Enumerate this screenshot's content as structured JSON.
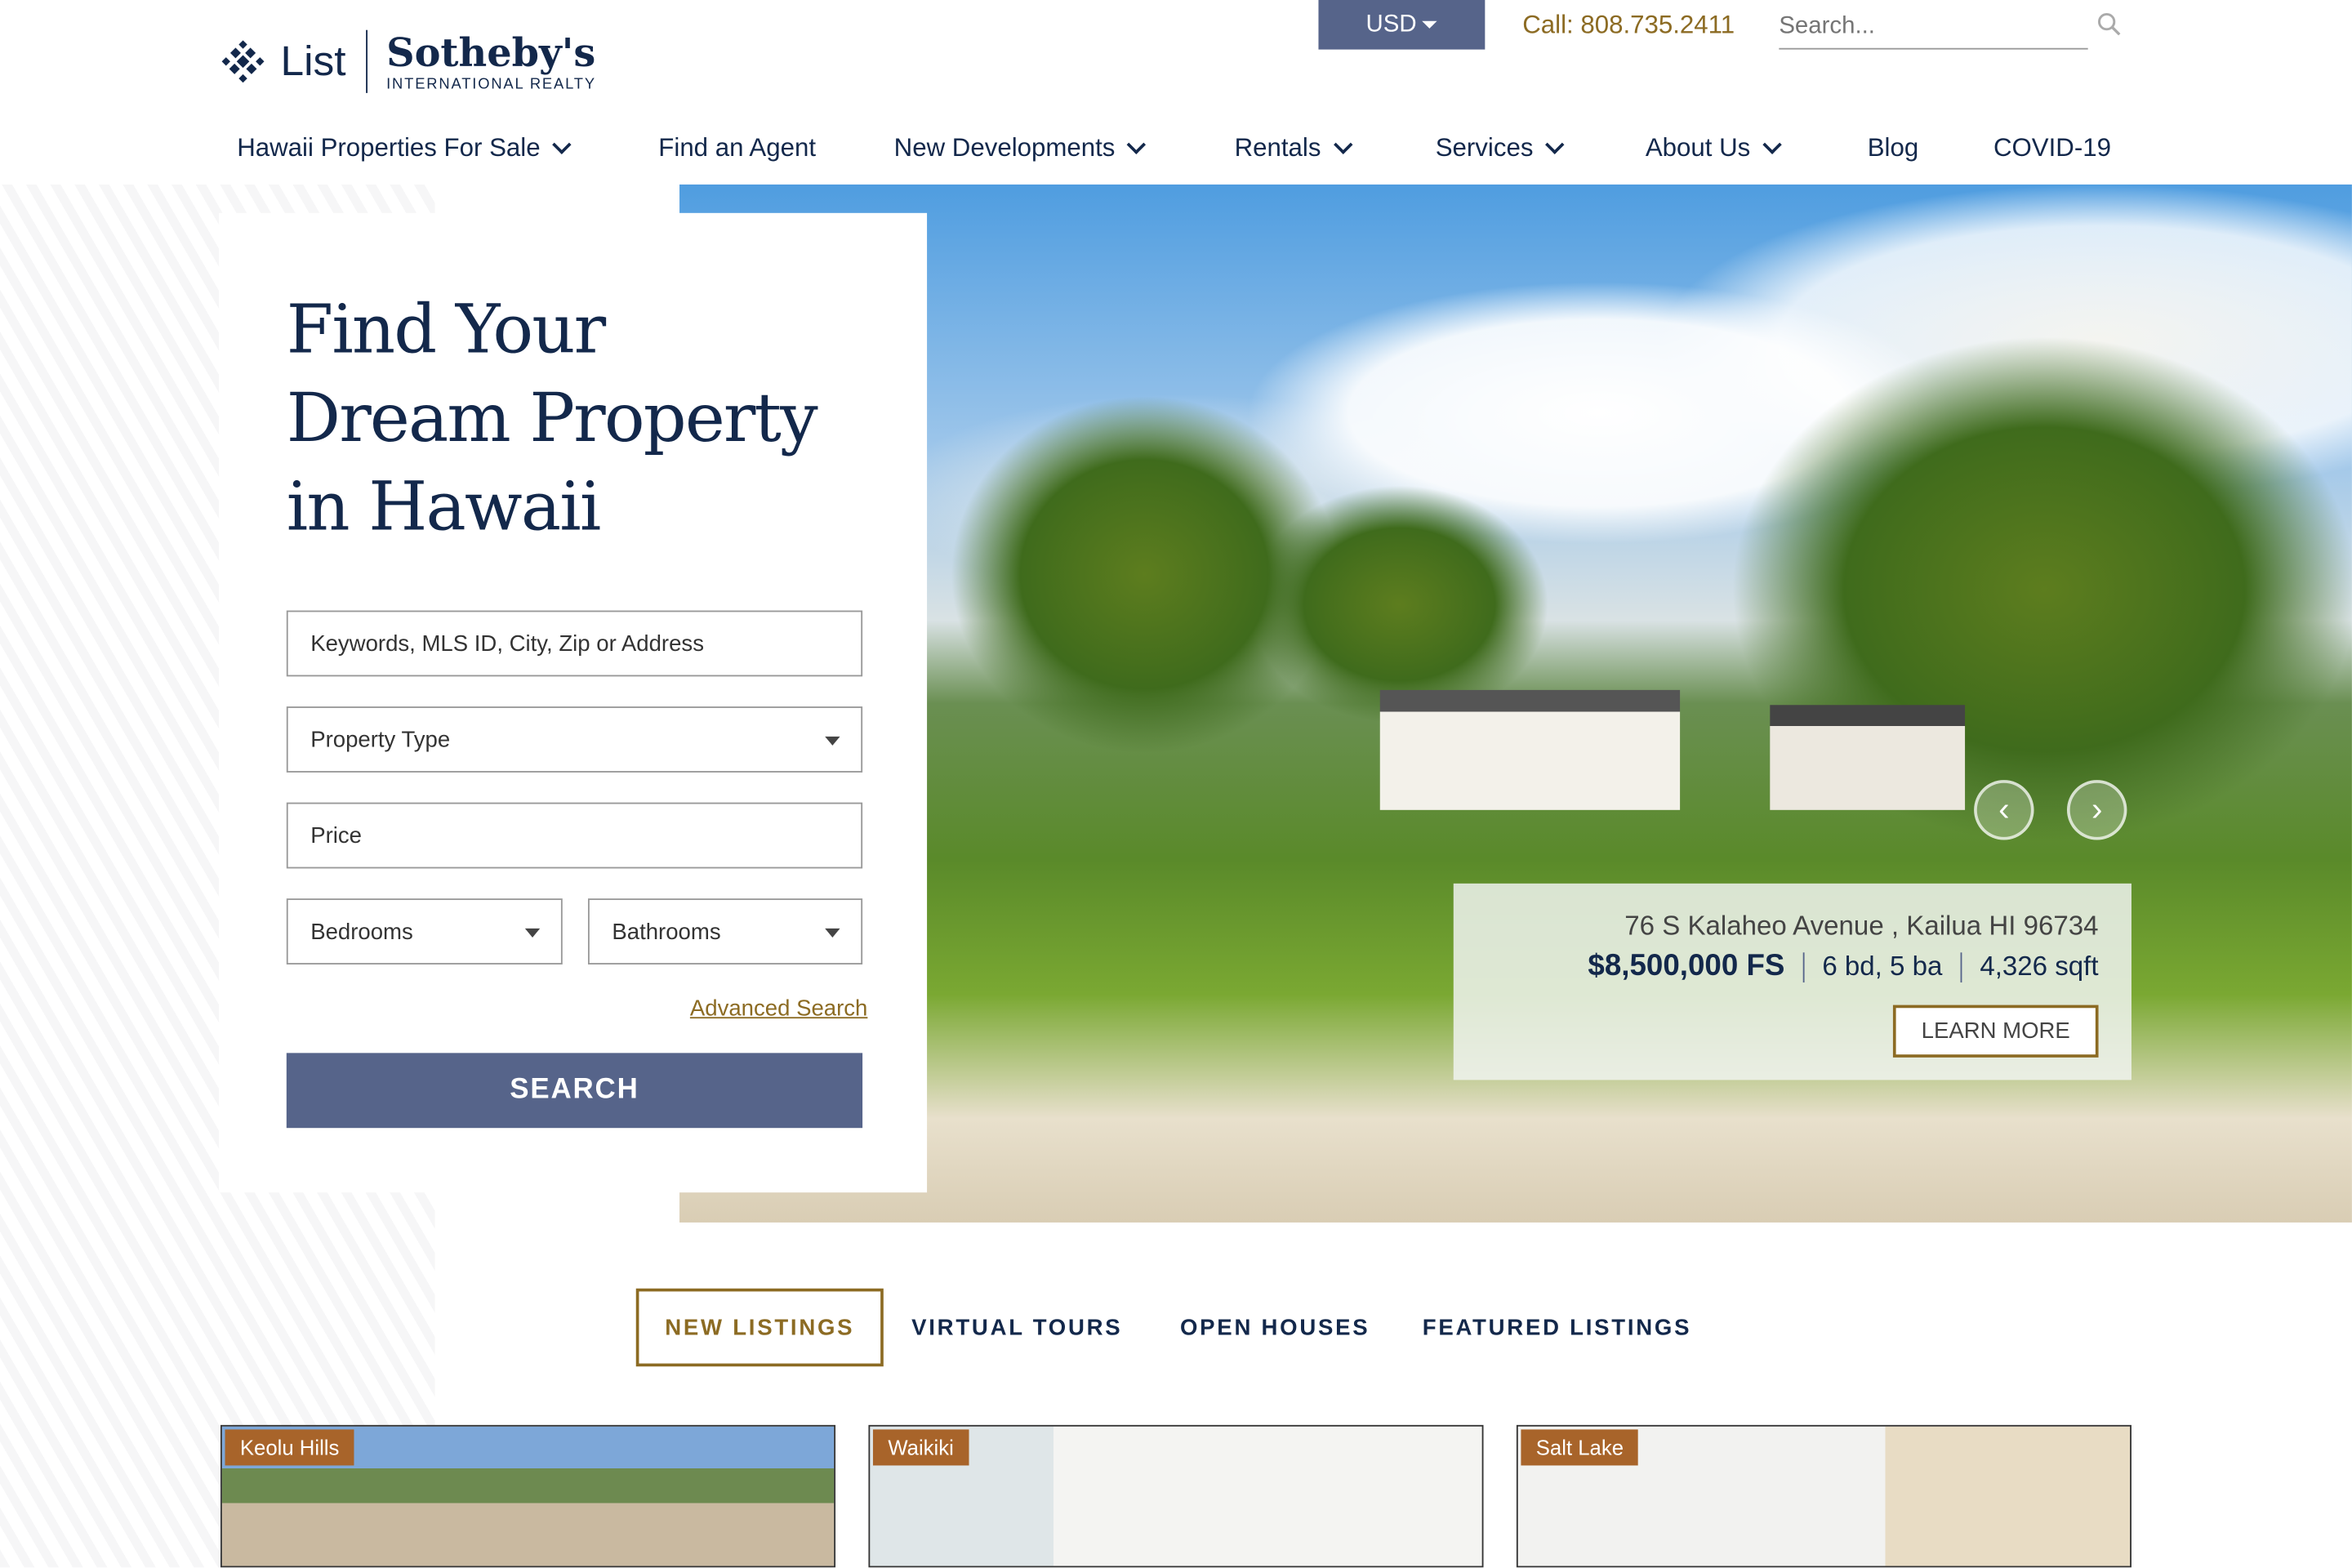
{
  "brand": {
    "list": "List",
    "name": "Sotheby's",
    "tagline": "INTERNATIONAL REALTY"
  },
  "topbar": {
    "currency": "USD",
    "phone": "Call: 808.735.2411",
    "search_placeholder": "Search..."
  },
  "nav": [
    {
      "label": "Hawaii Properties For Sale",
      "dropdown": true
    },
    {
      "label": "Find an Agent",
      "dropdown": false
    },
    {
      "label": "New Developments",
      "dropdown": true
    },
    {
      "label": "Rentals",
      "dropdown": true
    },
    {
      "label": "Services",
      "dropdown": true
    },
    {
      "label": "About Us",
      "dropdown": true
    },
    {
      "label": "Blog",
      "dropdown": false
    },
    {
      "label": "COVID-19",
      "dropdown": false
    }
  ],
  "hero": {
    "title_lines": [
      "Find Your",
      "Dream Property",
      "in Hawaii"
    ]
  },
  "search_form": {
    "keywords_placeholder": "Keywords, MLS ID, City, Zip or Address",
    "property_type": "Property Type",
    "price_placeholder": "Price",
    "bedrooms": "Bedrooms",
    "bathrooms": "Bathrooms",
    "advanced": "Advanced Search",
    "submit": "SEARCH"
  },
  "featured": {
    "address": "76 S Kalaheo Avenue , Kailua HI 96734",
    "price": "$8,500,000 FS",
    "beds_baths": "6 bd, 5 ba",
    "sqft": "4,326 sqft",
    "cta": "LEARN MORE"
  },
  "listing_tabs": [
    {
      "label": "NEW LISTINGS",
      "active": true
    },
    {
      "label": "VIRTUAL TOURS",
      "active": false
    },
    {
      "label": "OPEN HOUSES",
      "active": false
    },
    {
      "label": "FEATURED LISTINGS",
      "active": false
    }
  ],
  "listings": [
    {
      "badge": "Keolu Hills"
    },
    {
      "badge": "Waikiki"
    },
    {
      "badge": "Salt Lake"
    }
  ],
  "colors": {
    "navy": "#13284b",
    "gold": "#8c6b23",
    "slate": "#56648a",
    "badge": "#a8642a"
  }
}
